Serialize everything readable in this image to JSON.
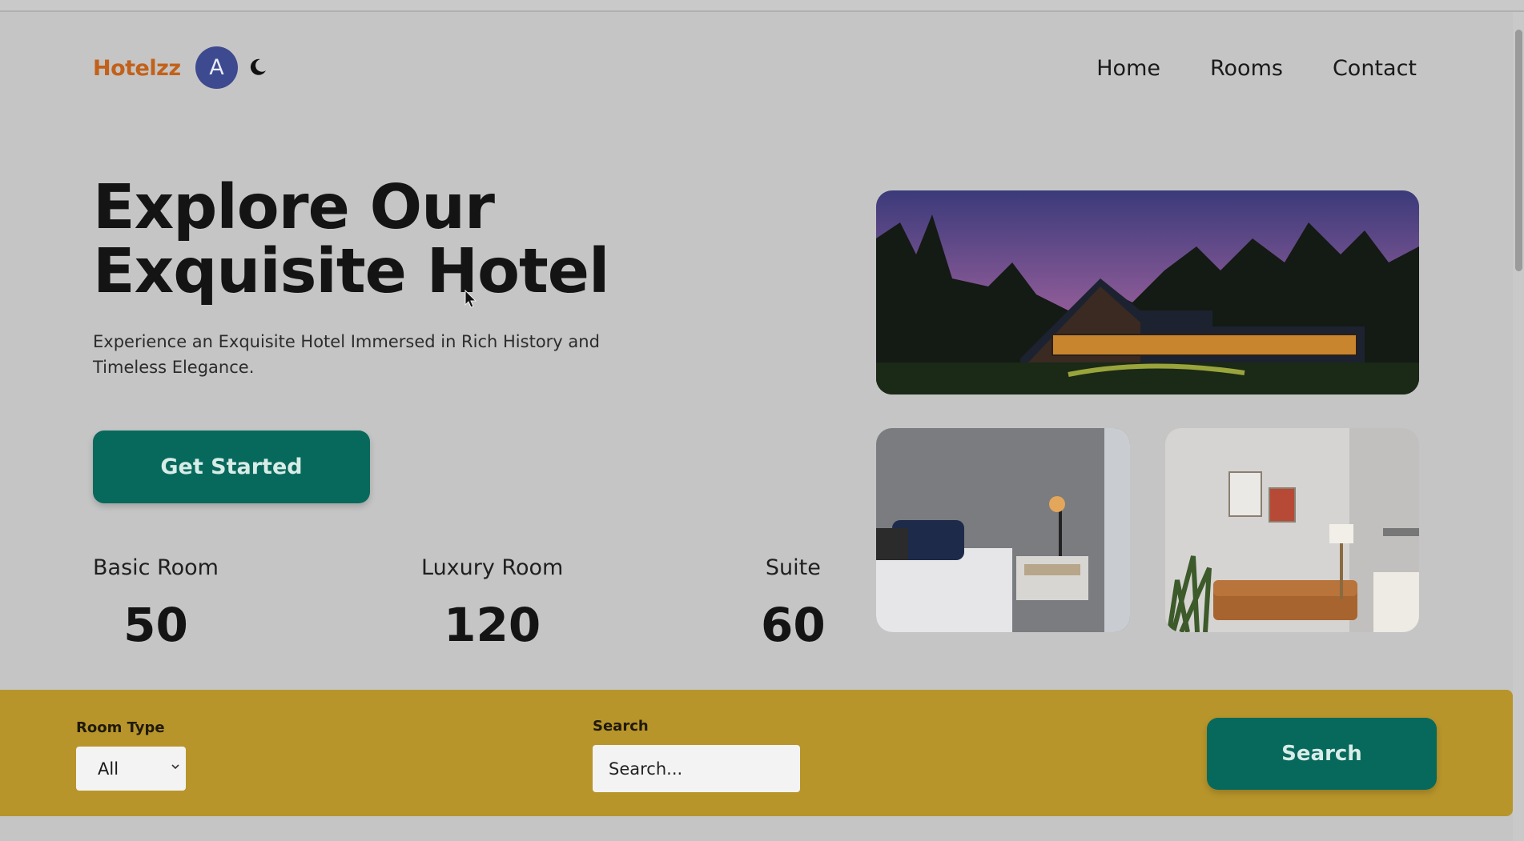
{
  "brand": {
    "logo": "Hotelzz",
    "avatar_initial": "A",
    "theme_icon": "moon-icon"
  },
  "nav": {
    "items": [
      "Home",
      "Rooms",
      "Contact"
    ]
  },
  "hero": {
    "title": "Explore Our Exquisite Hotel",
    "subtitle": "Experience an Exquisite Hotel Immersed in Rich History and Timeless Elegance.",
    "cta_label": "Get Started"
  },
  "stats": [
    {
      "label": "Basic Room",
      "value": "50"
    },
    {
      "label": "Luxury Room",
      "value": "120"
    },
    {
      "label": "Suite",
      "value": "60"
    }
  ],
  "filter": {
    "room_type_label": "Room Type",
    "room_type_value": "All",
    "search_label": "Search",
    "search_placeholder": "Search...",
    "search_button": "Search"
  },
  "colors": {
    "accent": "#07695c",
    "logo": "#c2611a",
    "bar": "#b8952b",
    "avatar": "#3d4a8f"
  }
}
